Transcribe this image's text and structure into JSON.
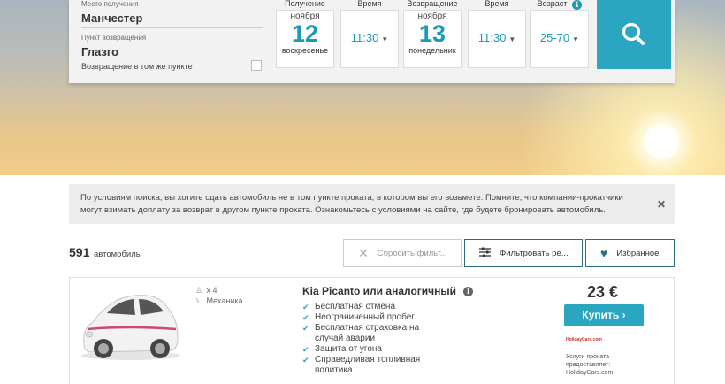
{
  "search": {
    "pickup_label": "Место получения",
    "pickup_value": "Манчестер",
    "return_label": "Пункт возвращения",
    "return_value": "Глазго",
    "same_point_label": "Возвращение в том же пункте",
    "pickup": {
      "label": "Получение",
      "month": "ноября",
      "day": "12",
      "weekday": "воскресенье"
    },
    "pickup_time": {
      "label": "Время",
      "value": "11:30"
    },
    "return": {
      "label": "Возвращение",
      "month": "ноября",
      "day": "13",
      "weekday": "понедельник"
    },
    "return_time": {
      "label": "Время",
      "value": "11:30"
    },
    "age": {
      "label": "Возраст",
      "value": "25-70"
    },
    "search_icon": "magnifier-icon"
  },
  "notice": {
    "text": "По условиям поиска, вы хотите сдать автомобиль не в том пункте проката, в котором вы его возьмете. Помните, что компании-прокатчики могут взимать доплату за возврат в другом пункте проката. Ознакомьтесь с условиями на сайте, где будете бронировать автомобиль.",
    "close": "✕"
  },
  "results": {
    "count": "591",
    "count_label": "автомобиль"
  },
  "toolbar": {
    "reset_label": "Сбросить фильт...",
    "filter_label": "Фильтровать ре...",
    "favorites_label": "Избранное"
  },
  "car": {
    "seats": "x 4",
    "transmission": "Механика",
    "title": "Kia Picanto или аналогичный",
    "features": [
      "Бесплатная отмена",
      "Неограниченный пробег",
      "Бесплатная страховка на случай аварии",
      "Защита от угона",
      "Справедливая топливная политика"
    ],
    "price": "23 €",
    "buy_label": "Купить",
    "provider_logo": "HolidayCars.com",
    "provider_text": "Услуги проката предоставляет: HolidayCars.com"
  },
  "colors": {
    "accent": "#2aa6c1",
    "button_border": "#2b6e83"
  }
}
